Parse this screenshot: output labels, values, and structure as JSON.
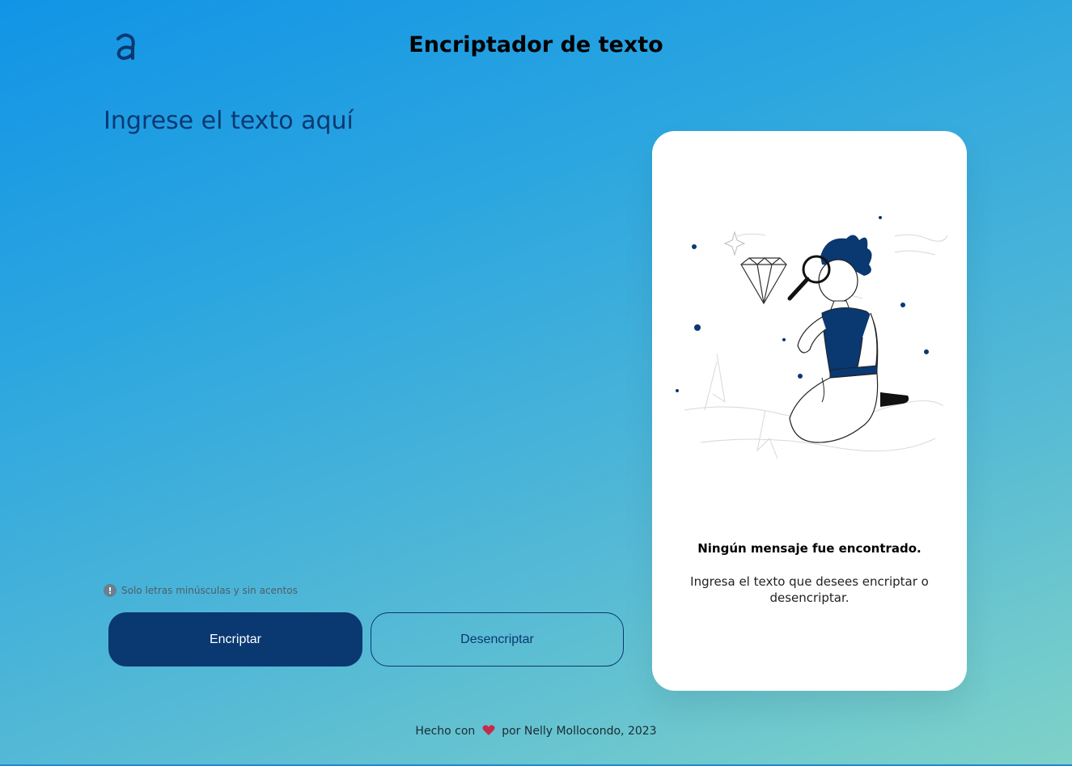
{
  "header": {
    "logo_icon": "alura-logo-icon",
    "title": "Encriptador de texto"
  },
  "main": {
    "input_placeholder": "Ingrese el texto aquí",
    "hint_icon": "info-icon",
    "hint_icon_glyph": "!",
    "hint_text": "Solo letras minúsculas y sin acentos",
    "encrypt_label": "Encriptar",
    "decrypt_label": "Desencriptar"
  },
  "output": {
    "illustration": "person-with-magnifying-glass-and-diamond",
    "title": "Ningún mensaje fue encontrado.",
    "description": "Ingresa el texto que desees encriptar o desencriptar."
  },
  "footer": {
    "before": "Hecho con",
    "heart_icon": "heart-icon",
    "after": "por Nelly Mollocondo, 2023"
  },
  "colors": {
    "primary": "#0a3871",
    "card_bg": "#ffffff",
    "gradient_start": "#1294e6",
    "gradient_end": "#7fd2c8",
    "heart": "#c62a4a"
  }
}
